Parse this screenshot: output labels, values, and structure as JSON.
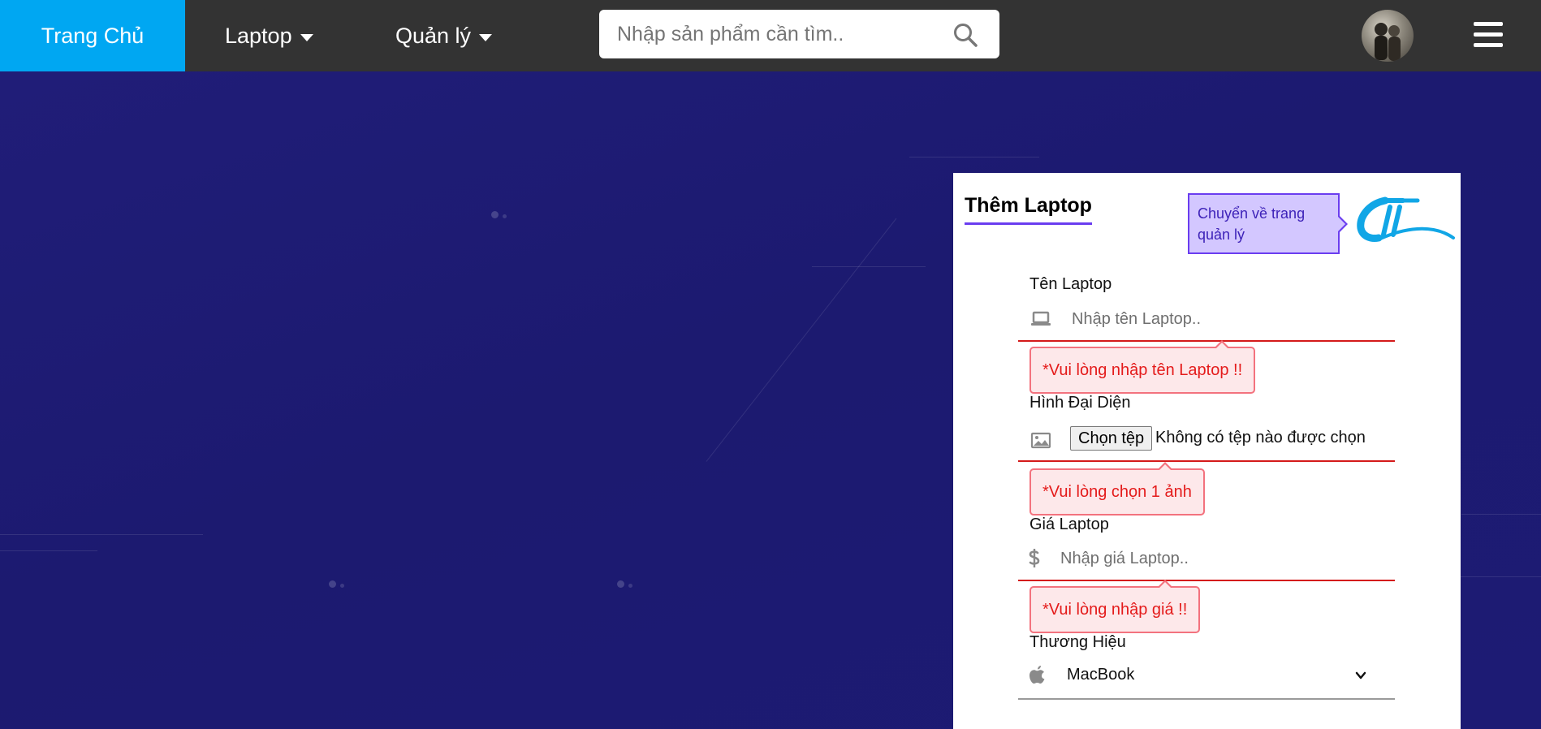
{
  "nav": {
    "home": "Trang Chủ",
    "laptop": "Laptop",
    "manage": "Quản lý",
    "search_placeholder": "Nhập sản phẩm cần tìm..",
    "icons": [
      "search-icon",
      "avatar",
      "hamburger-menu-icon"
    ]
  },
  "form": {
    "title": "Thêm Laptop",
    "back_tooltip": "Chuyển về trang quản lý",
    "fields": {
      "name": {
        "label": "Tên Laptop",
        "placeholder": "Nhập tên Laptop..",
        "error": "*Vui lòng nhập tên Laptop !!",
        "icon": "laptop-icon"
      },
      "image": {
        "label": "Hình Đại Diện",
        "button": "Chọn tệp",
        "status": "Không có tệp nào được chọn",
        "error": "*Vui lòng chọn 1 ảnh",
        "icon": "image-icon"
      },
      "price": {
        "label": "Giá Laptop",
        "placeholder": "Nhập giá Laptop..",
        "error": "*Vui lòng nhập giá !!",
        "icon": "dollar-icon"
      },
      "brand": {
        "label": "Thương Hiệu",
        "value": "MacBook",
        "icon": "apple-icon"
      }
    }
  },
  "colors": {
    "nav_bg": "#333333",
    "home_bg": "#00a7f2",
    "page_bg": "#1d1b72",
    "accent": "#6a3df0",
    "error": "#e41b1b"
  }
}
